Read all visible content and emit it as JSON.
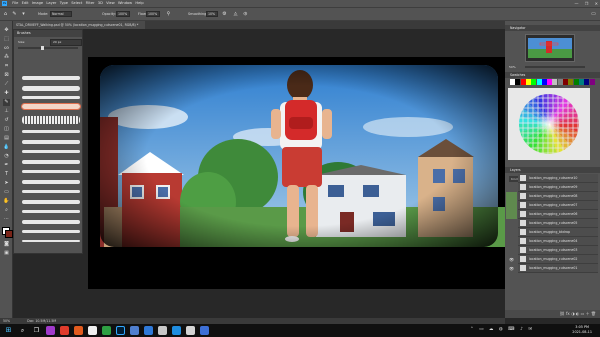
{
  "menubar": {
    "app_icon": "Ps",
    "items": [
      "File",
      "Edit",
      "Image",
      "Layer",
      "Type",
      "Select",
      "Filter",
      "3D",
      "View",
      "Window",
      "Help"
    ],
    "window_controls": [
      "—",
      "❐",
      "✕"
    ]
  },
  "options": {
    "mode_label": "Mode:",
    "mode_value": "Normal",
    "opacity_label": "Opacity:",
    "opacity_value": "100%",
    "flow_label": "Flow:",
    "flow_value": "100%",
    "smoothing_label": "Smoothing:",
    "smoothing_value": "10%"
  },
  "document": {
    "tab_title": "STAL_DRIVEFF_Walking.psd @ 50% (location_mugging_cutscene01, RGB/8) *"
  },
  "brushes_panel": {
    "title": "Brushes",
    "size_label": "Size:",
    "size_value": "20 px",
    "slider_fraction": 0.4
  },
  "navigator": {
    "title": "Navigator",
    "zoom": "50%"
  },
  "swatches": {
    "title": "Swatches",
    "colors": [
      "#ffffff",
      "#000000",
      "#ff0000",
      "#ffff00",
      "#00ff00",
      "#00ffff",
      "#0000ff",
      "#ff00ff",
      "#c0c0c0",
      "#808080",
      "#800000",
      "#808000",
      "#008000",
      "#008080",
      "#000080",
      "#800080"
    ]
  },
  "layers": {
    "title": "Layers",
    "kind_label": "Kind",
    "items": [
      "location_mugging_cutscene10",
      "location_mugging_cutscene09",
      "location_mugging_cutscene08",
      "location_mugging_cutscene07",
      "location_mugging_cutscene06",
      "location_mugging_cutscene05",
      "location_mugging_bkdrop",
      "location_mugging_cutscene04",
      "location_mugging_cutscene03",
      "location_mugging_cutscene02",
      "location_mugging_cutscene01"
    ]
  },
  "statusbar": {
    "zoom": "50%",
    "doc_info": "Doc: 10.5M/11.5M"
  },
  "taskbar": {
    "time": "3:05 PM",
    "date": "2021-08-11"
  }
}
